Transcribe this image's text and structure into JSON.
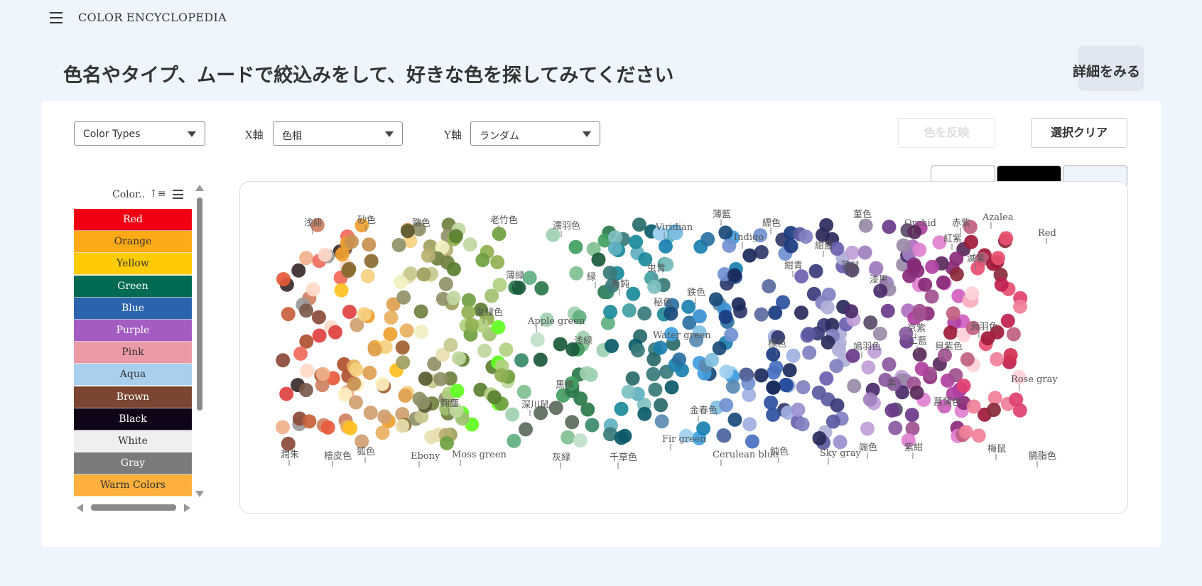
{
  "header": {
    "brand": "COLOR ENCYCLOPEDIA",
    "headline": "色名やタイプ、ムードで絞込みをして、好きな色を探してみてください",
    "details_label": "詳細をみる"
  },
  "filters": {
    "type_select": "Color Types",
    "x_axis_label": "X軸",
    "x_axis_value": "色相",
    "y_axis_label": "Y軸",
    "y_axis_value": "ランダム",
    "apply_label": "色を反映",
    "clear_label": "選択クリア"
  },
  "background_swatches": [
    {
      "name": "white",
      "color": "#ffffff"
    },
    {
      "name": "black",
      "color": "#000000"
    },
    {
      "name": "light-blue",
      "color": "#eef5fc"
    }
  ],
  "list": {
    "header": "Color..",
    "items": [
      {
        "label": "Red",
        "bg": "#f10014",
        "fg": "#ffffff"
      },
      {
        "label": "Orange",
        "bg": "#fdaa17",
        "fg": "#333333"
      },
      {
        "label": "Yellow",
        "bg": "#ffcb05",
        "fg": "#333333"
      },
      {
        "label": "Green",
        "bg": "#006a53",
        "fg": "#ffffff"
      },
      {
        "label": "Blue",
        "bg": "#2b63ad",
        "fg": "#ffffff"
      },
      {
        "label": "Purple",
        "bg": "#a25cc2",
        "fg": "#ffffff"
      },
      {
        "label": "Pink",
        "bg": "#ed9aa7",
        "fg": "#333333"
      },
      {
        "label": "Aqua",
        "bg": "#a9cfee",
        "fg": "#333333"
      },
      {
        "label": "Brown",
        "bg": "#7a4632",
        "fg": "#ffffff"
      },
      {
        "label": "Black",
        "bg": "#0f0418",
        "fg": "#ffffff"
      },
      {
        "label": "White",
        "bg": "#efefef",
        "fg": "#333333"
      },
      {
        "label": "Gray",
        "bg": "#7b7b7b",
        "fg": "#ffffff"
      },
      {
        "label": "Warm Colors",
        "bg": "#fdb03b",
        "fg": "#333333"
      }
    ]
  },
  "plot_labels": [
    {
      "text": "浅緋"
    },
    {
      "text": "砂色"
    },
    {
      "text": "鶸色"
    },
    {
      "text": "老竹色"
    },
    {
      "text": "濡羽色"
    },
    {
      "text": "Viridian"
    },
    {
      "text": "薄藍"
    },
    {
      "text": "縹色"
    },
    {
      "text": "菫色"
    },
    {
      "text": "Orchid"
    },
    {
      "text": "Azalea"
    },
    {
      "text": "赤紫"
    },
    {
      "text": "Red"
    },
    {
      "text": "Indigo"
    },
    {
      "text": "紅紫"
    },
    {
      "text": "紺藍"
    },
    {
      "text": "紺青"
    },
    {
      "text": "薄鼠"
    },
    {
      "text": "滅紫"
    },
    {
      "text": "虫青"
    },
    {
      "text": "薄緑"
    },
    {
      "text": "緑"
    },
    {
      "text": "青鈍"
    },
    {
      "text": "漆黒"
    },
    {
      "text": "鉄色"
    },
    {
      "text": "秘色"
    },
    {
      "text": "海緑色"
    },
    {
      "text": "Apple green"
    },
    {
      "text": "京紫"
    },
    {
      "text": "烏羽色"
    },
    {
      "text": "Water green"
    },
    {
      "text": "浅緑"
    },
    {
      "text": "二藍"
    },
    {
      "text": "橡色"
    },
    {
      "text": "鳩羽色"
    },
    {
      "text": "貝紫色"
    },
    {
      "text": "黒"
    },
    {
      "text": "黒橡"
    },
    {
      "text": "Rose gray"
    },
    {
      "text": "麹塵"
    },
    {
      "text": "深川鼠"
    },
    {
      "text": "菖蒲色"
    },
    {
      "text": "金春色"
    },
    {
      "text": "Fir green"
    },
    {
      "text": "潤朱"
    },
    {
      "text": "檜皮色"
    },
    {
      "text": "狐色"
    },
    {
      "text": "Ebony"
    },
    {
      "text": "Moss green"
    },
    {
      "text": "灰緑"
    },
    {
      "text": "千草色"
    },
    {
      "text": "Cerulean blue"
    },
    {
      "text": "鈍色"
    },
    {
      "text": "Sky gray"
    },
    {
      "text": "端色"
    },
    {
      "text": "紫紺"
    },
    {
      "text": "梅鼠"
    },
    {
      "text": "臙脂色"
    }
  ]
}
